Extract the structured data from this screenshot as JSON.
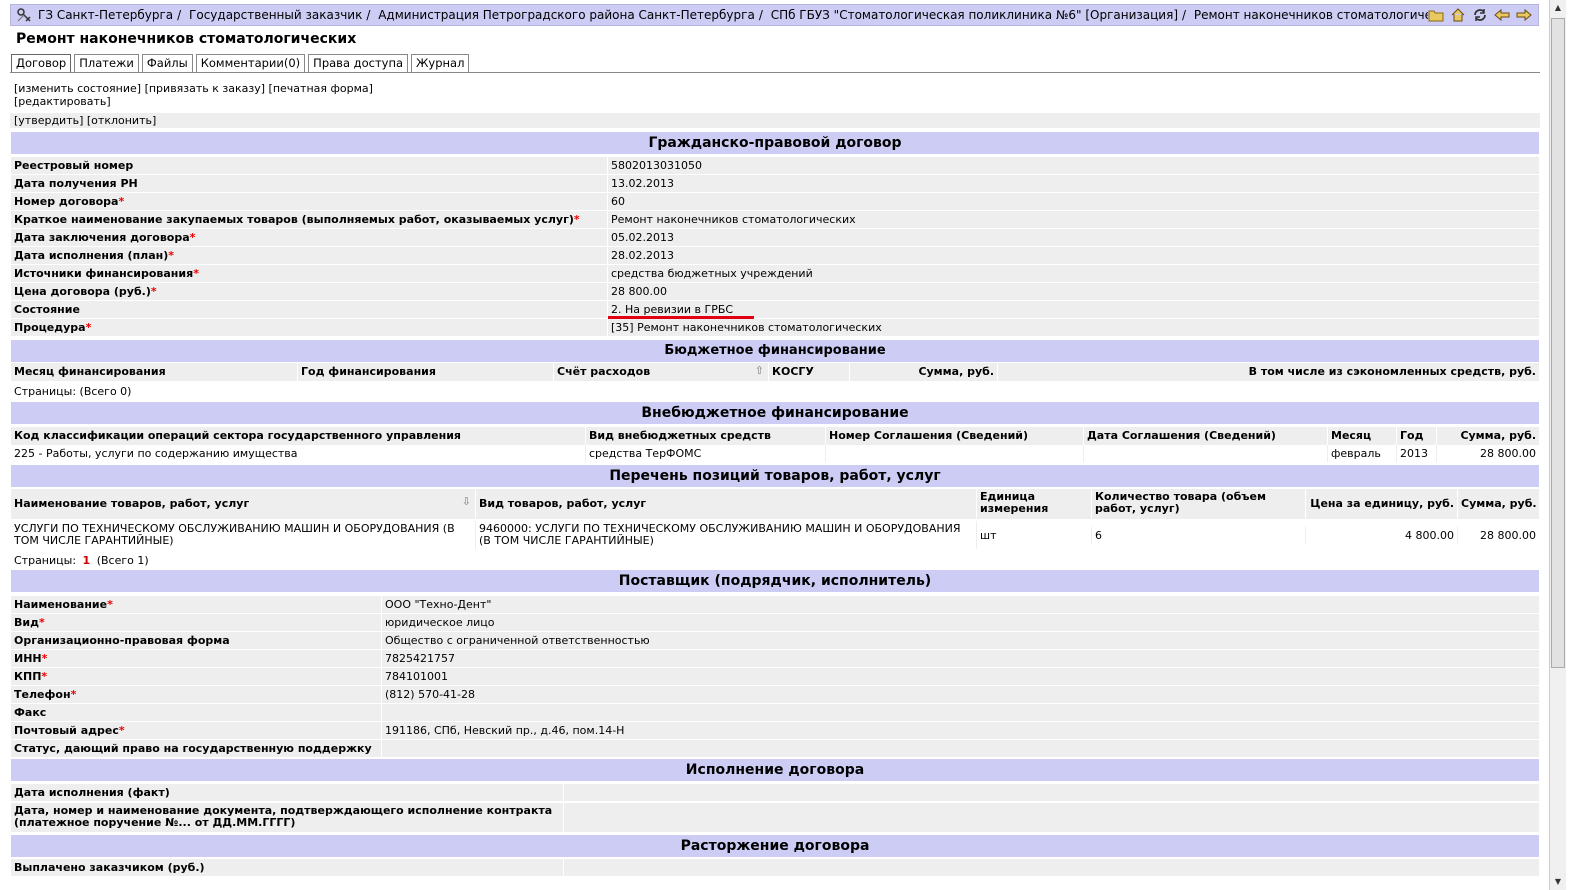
{
  "breadcrumb": [
    "ГЗ Санкт-Петербурга",
    "Государственный заказчик",
    "Администрация Петроградского района Санкт-Петербурга",
    "СПб ГБУЗ \"Стоматологическая поликлиника №6\" [Организация]",
    "Ремонт наконечников стоматологических [Договор]"
  ],
  "title": "Ремонт наконечников стоматологических",
  "tabs": [
    "Договор",
    "Платежи",
    "Файлы",
    "Комментарии(0)",
    "Права доступа",
    "Журнал"
  ],
  "actions": {
    "change_state": "[изменить состояние]",
    "bind_order": "[привязать к заказу]",
    "print_form": "[печатная форма]",
    "edit": "[редактировать]",
    "approve": "[утвердить]",
    "reject": "[отклонить]"
  },
  "contract": {
    "header": "Гражданско-правовой договор",
    "rows": [
      {
        "label": "Реестровый номер",
        "req": false,
        "value": "5802013031050"
      },
      {
        "label": "Дата получения РН",
        "req": false,
        "value": "13.02.2013"
      },
      {
        "label": "Номер договора",
        "req": true,
        "value": "60"
      },
      {
        "label": "Краткое наименование закупаемых товаров (выполняемых работ, оказываемых услуг)",
        "req": true,
        "value": "Ремонт наконечников стоматологических"
      },
      {
        "label": "Дата заключения договора",
        "req": true,
        "value": "05.02.2013"
      },
      {
        "label": "Дата исполнения (план)",
        "req": true,
        "value": "28.02.2013"
      },
      {
        "label": "Источники финансирования",
        "req": true,
        "value": "средства бюджетных учреждений"
      },
      {
        "label": "Цена договора (руб.)",
        "req": true,
        "value": "28 800.00"
      },
      {
        "label": "Состояние",
        "req": false,
        "value": "2. На ревизии в ГРБС"
      },
      {
        "label": "Процедура",
        "req": true,
        "value": "[35] Ремонт наконечников стоматологических"
      }
    ]
  },
  "budget": {
    "header": "Бюджетное финансирование",
    "columns": [
      "Месяц финансирования",
      "Год финансирования",
      "Счёт расходов",
      "КОСГУ",
      "Сумма, руб.",
      "В том числе из сэкономленных средств, руб."
    ],
    "pager": "Страницы:  (Всего 0)"
  },
  "extrabudget": {
    "header": "Внебюджетное финансирование",
    "columns": [
      "Код классификации операций сектора государственного управления",
      "Вид внебюджетных средств",
      "Номер Соглашения (Сведений)",
      "Дата Соглашения (Сведений)",
      "Месяц",
      "Год",
      "Сумма, руб."
    ],
    "row": [
      "225 - Работы, услуги по содержанию имущества",
      "средства ТерФОМС",
      "",
      "",
      "февраль",
      "2013",
      "28 800.00"
    ]
  },
  "items": {
    "header": "Перечень позиций товаров, работ, услуг",
    "columns": [
      "Наименование товаров, работ, услуг",
      "Вид товаров, работ, услуг",
      "Единица измерения",
      "Количество товара (объем работ, услуг)",
      "Цена за единицу, руб.",
      "Сумма, руб."
    ],
    "row": [
      "УСЛУГИ ПО ТЕХНИЧЕСКОМУ ОБСЛУЖИВАНИЮ МАШИН И ОБОРУДОВАНИЯ (В ТОМ ЧИСЛЕ ГАРАНТИЙНЫЕ)",
      "9460000: УСЛУГИ ПО ТЕХНИЧЕСКОМУ ОБСЛУЖИВАНИЮ МАШИН И ОБОРУДОВАНИЯ (В ТОМ ЧИСЛЕ ГАРАНТИЙНЫЕ)",
      "шт",
      "6",
      "4 800.00",
      "28 800.00"
    ],
    "pager_prefix": "Страницы:",
    "pager_current": "1",
    "pager_total": "(Всего 1)"
  },
  "supplier": {
    "header": "Поставщик (подрядчик, исполнитель)",
    "rows": [
      {
        "label": "Наименование",
        "req": true,
        "value": "ООО \"Техно-Дент\""
      },
      {
        "label": "Вид",
        "req": true,
        "value": "юридическое лицо"
      },
      {
        "label": "Организационно-правовая форма",
        "req": false,
        "value": "Общество с ограниченной ответственностью"
      },
      {
        "label": "ИНН",
        "req": true,
        "value": "7825421757"
      },
      {
        "label": "КПП",
        "req": true,
        "value": "784101001"
      },
      {
        "label": "Телефон",
        "req": true,
        "value": "(812) 570-41-28"
      },
      {
        "label": "Факс",
        "req": false,
        "value": ""
      },
      {
        "label": "Почтовый адрес",
        "req": true,
        "value": "191186, СПб, Невский пр., д.46, пом.14-Н"
      },
      {
        "label": "Статус, дающий право на государственную поддержку",
        "req": false,
        "value": ""
      }
    ]
  },
  "execution": {
    "header": "Исполнение договора",
    "row1": "Дата исполнения (факт)",
    "row2": "Дата, номер и наименование документа, подтверждающего исполнение контракта (платежное поручение №... от ДД.ММ.ГГГГ)"
  },
  "termination": {
    "header": "Расторжение договора",
    "row1": "Выплачено заказчиком (руб.)"
  },
  "colors": {
    "header_bg": "#ccccf5",
    "row_bg": "#eeeeee",
    "required": "#ee0000",
    "highlight": "#e00010"
  }
}
